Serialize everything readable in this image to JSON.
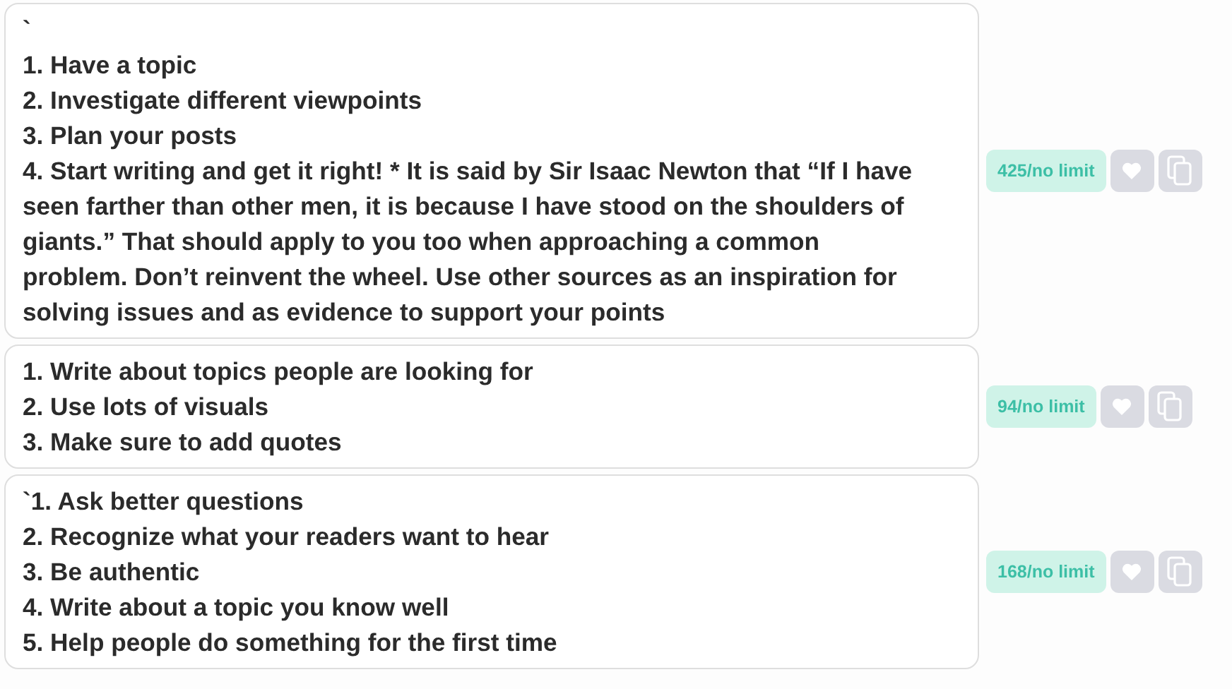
{
  "items": [
    {
      "text": "`\n1. Have a topic\n2. Investigate different viewpoints\n3. Plan your posts\n4. Start writing and get it right! * It is said by Sir Isaac Newton that “If I have seen farther than other men, it is because I have stood on the shoulders of giants.” That should apply to you too when approaching a common problem. Don’t reinvent the wheel. Use other sources as an inspiration for solving issues and as evidence to support your points",
      "count": "425/no limit"
    },
    {
      "text": "1. Write about topics people are looking for\n2. Use lots of visuals\n3. Make sure to add quotes",
      "count": "94/no limit"
    },
    {
      "text": "`1. Ask better questions\n2. Recognize what your readers want to hear\n3. Be authentic\n4. Write about a topic you know well\n5. Help people do something for the first time",
      "count": "168/no limit"
    }
  ]
}
